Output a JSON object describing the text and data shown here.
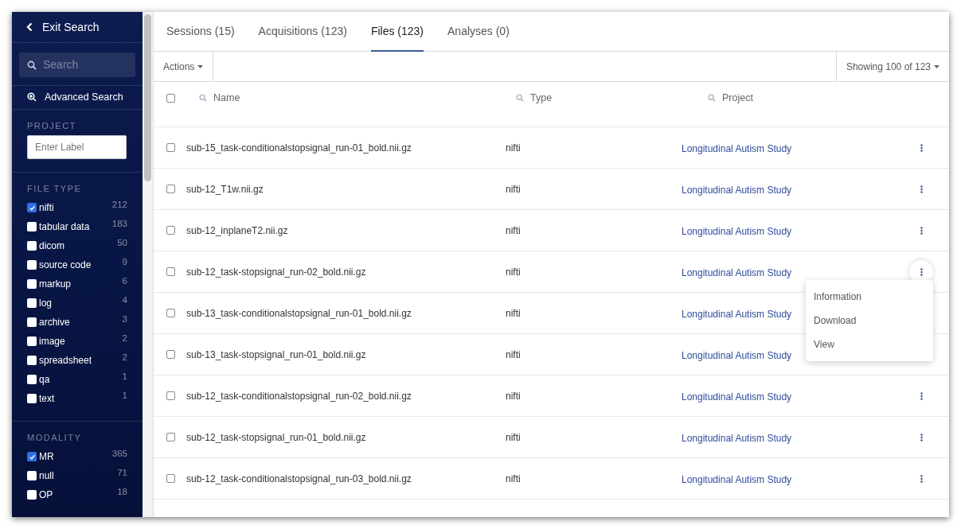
{
  "sidebar": {
    "exit_label": "Exit Search",
    "search": {
      "placeholder": "Search"
    },
    "advanced_search": "Advanced Search",
    "project": {
      "heading": "PROJECT",
      "placeholder": "Enter Label"
    },
    "facets": [
      {
        "heading": "FILE TYPE",
        "items": [
          {
            "label": "nifti",
            "count": "212",
            "checked": true
          },
          {
            "label": "tabular data",
            "count": "183",
            "checked": false
          },
          {
            "label": "dicom",
            "count": "50",
            "checked": false
          },
          {
            "label": "source code",
            "count": "9",
            "checked": false
          },
          {
            "label": "markup",
            "count": "6",
            "checked": false
          },
          {
            "label": "log",
            "count": "4",
            "checked": false
          },
          {
            "label": "archive",
            "count": "3",
            "checked": false
          },
          {
            "label": "image",
            "count": "2",
            "checked": false
          },
          {
            "label": "spreadsheet",
            "count": "2",
            "checked": false
          },
          {
            "label": "qa",
            "count": "1",
            "checked": false
          },
          {
            "label": "text",
            "count": "1",
            "checked": false
          }
        ]
      },
      {
        "heading": "MODALITY",
        "items": [
          {
            "label": "MR",
            "count": "365",
            "checked": true
          },
          {
            "label": "null",
            "count": "71",
            "checked": false
          },
          {
            "label": "OP",
            "count": "18",
            "checked": false
          }
        ]
      }
    ]
  },
  "tabs": [
    {
      "label": "Sessions (15)",
      "selected": false
    },
    {
      "label": "Acquisitions (123)",
      "selected": false
    },
    {
      "label": "Files (123)",
      "selected": true
    },
    {
      "label": "Analyses (0)",
      "selected": false
    }
  ],
  "toolbar": {
    "actions": "Actions",
    "paging": "Showing 100 of 123"
  },
  "table": {
    "all_checked": false,
    "columns": [
      "Name",
      "Type",
      "Project"
    ],
    "rows": [
      {
        "name": "sub-15_task-conditionalstopsignal_run-01_bold.nii.gz",
        "type": "nifti",
        "project": "Longitudinal Autism Study",
        "checked": false,
        "menu_open": false
      },
      {
        "name": "sub-12_T1w.nii.gz",
        "type": "nifti",
        "project": "Longitudinal Autism Study",
        "checked": false,
        "menu_open": false
      },
      {
        "name": "sub-12_inplaneT2.nii.gz",
        "type": "nifti",
        "project": "Longitudinal Autism Study",
        "checked": false,
        "menu_open": false
      },
      {
        "name": "sub-12_task-stopsignal_run-02_bold.nii.gz",
        "type": "nifti",
        "project": "Longitudinal Autism Study",
        "checked": false,
        "menu_open": true
      },
      {
        "name": "sub-13_task-conditionalstopsignal_run-01_bold.nii.gz",
        "type": "nifti",
        "project": "Longitudinal Autism Study",
        "checked": false,
        "menu_open": false
      },
      {
        "name": "sub-13_task-stopsignal_run-01_bold.nii.gz",
        "type": "nifti",
        "project": "Longitudinal Autism Study",
        "checked": false,
        "menu_open": false
      },
      {
        "name": "sub-12_task-conditionalstopsignal_run-02_bold.nii.gz",
        "type": "nifti",
        "project": "Longitudinal Autism Study",
        "checked": false,
        "menu_open": false
      },
      {
        "name": "sub-12_task-stopsignal_run-01_bold.nii.gz",
        "type": "nifti",
        "project": "Longitudinal Autism Study",
        "checked": false,
        "menu_open": false
      },
      {
        "name": "sub-12_task-conditionalstopsignal_run-03_bold.nii.gz",
        "type": "nifti",
        "project": "Longitudinal Autism Study",
        "checked": false,
        "menu_open": false
      }
    ]
  },
  "row_menu": [
    "Information",
    "Download",
    "View"
  ]
}
